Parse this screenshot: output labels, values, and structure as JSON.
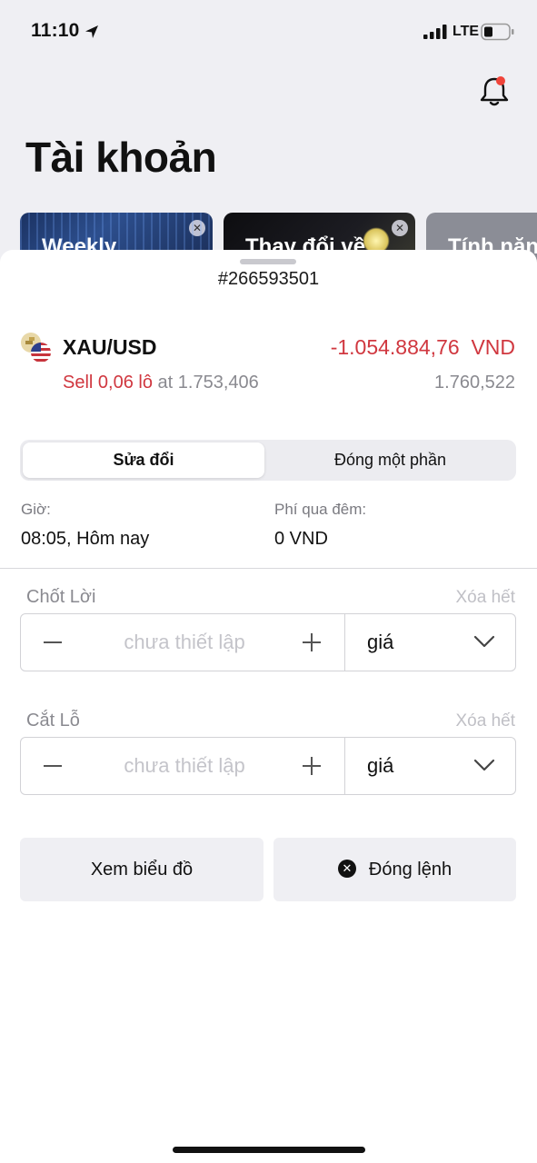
{
  "status_bar": {
    "time": "11:10",
    "network": "LTE"
  },
  "page": {
    "title": "Tài khoản"
  },
  "promo_cards": [
    {
      "title": "Weekly"
    },
    {
      "title": "Thay đổi về"
    },
    {
      "title": "Tính năng"
    }
  ],
  "sheet": {
    "order_id": "#266593501",
    "instrument": {
      "name": "XAU/USD",
      "pnl": "-1.054.884,76",
      "pnl_currency": "VND",
      "side_volume": "Sell 0,06 lô",
      "at_label": "at",
      "open_price": "1.753,406",
      "current_price": "1.760,522"
    },
    "tabs": {
      "modify": "Sửa đổi",
      "partial_close": "Đóng một phần"
    },
    "time": {
      "label": "Giờ:",
      "value": "08:05, Hôm nay"
    },
    "swap": {
      "label": "Phí qua đêm:",
      "value": "0 VND"
    },
    "take_profit": {
      "label": "Chốt Lời",
      "clear": "Xóa hết",
      "placeholder": "chưa thiết lập",
      "type": "giá"
    },
    "stop_loss": {
      "label": "Cắt Lỗ",
      "clear": "Xóa hết",
      "placeholder": "chưa thiết lập",
      "type": "giá"
    },
    "buttons": {
      "view_chart": "Xem biểu đồ",
      "close_order": "Đóng lệnh"
    }
  },
  "colors": {
    "loss_red": "#d0373f",
    "notification_dot": "#f0443a",
    "muted_text": "#8a8a90"
  },
  "icons": [
    "location-arrow-icon",
    "signal-icon",
    "battery-icon",
    "bell-icon",
    "close-icon",
    "gold-coin-icon",
    "us-flag-icon",
    "minus-icon",
    "plus-icon",
    "chevron-down-icon",
    "close-circle-icon"
  ]
}
